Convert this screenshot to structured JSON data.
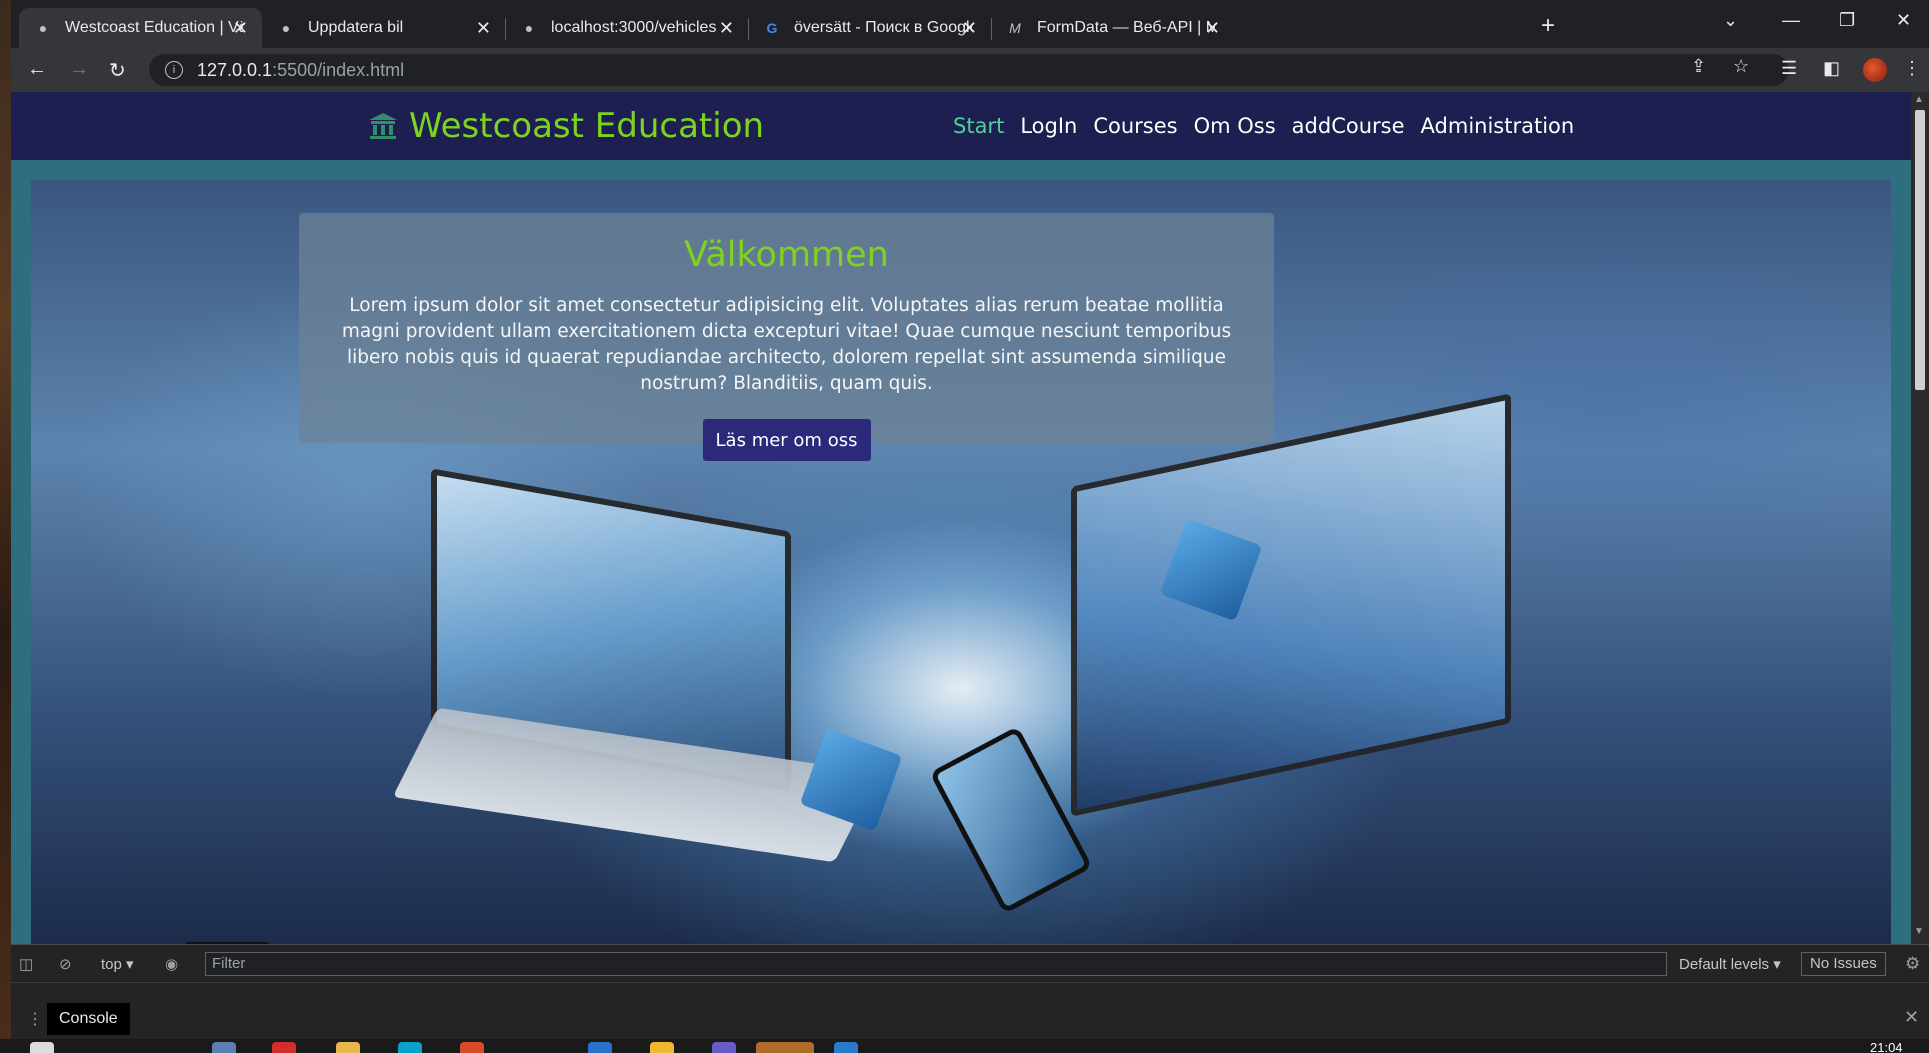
{
  "browser": {
    "tabs": [
      {
        "title": "Westcoast Education | Välkommen",
        "favicon": "globe-icon",
        "active": true
      },
      {
        "title": "Uppdatera bil",
        "favicon": "globe-icon",
        "active": false
      },
      {
        "title": "localhost:3000/vehicles",
        "favicon": "globe-icon",
        "active": false
      },
      {
        "title": "översätt - Поиск в Google",
        "favicon": "google-icon",
        "active": false
      },
      {
        "title": "FormData — Веб-API | MДН",
        "favicon": "mdn-icon",
        "active": false
      }
    ],
    "address": {
      "host": "127.0.0.1",
      "path": ":5500/index.html"
    },
    "mdn_glyph": "M",
    "google_glyph": "G"
  },
  "site": {
    "brand": "Westcoast Education",
    "brand_color": "#7ed321",
    "header_bg": "#1c1f4f",
    "nav": [
      {
        "label": "Start",
        "active": true
      },
      {
        "label": "LogIn",
        "active": false
      },
      {
        "label": "Courses",
        "active": false
      },
      {
        "label": "Om Oss",
        "active": false
      },
      {
        "label": "addCourse",
        "active": false
      },
      {
        "label": "Administration",
        "active": false
      }
    ],
    "hero": {
      "heading": "Välkommen",
      "text": "Lorem ipsum dolor sit amet consectetur adipisicing elit. Voluptates alias rerum beatae mollitia magni provident ullam exercitationem dicta excepturi vitae! Quae cumque nesciunt temporibus libero nobis quis id quaerat repudiandae architecto, dolorem repellat sint assumenda similique nostrum? Blanditiis, quam quis.",
      "button": "Läs mer om oss",
      "button_color": "#2b2a7a"
    }
  },
  "devtools": {
    "context": "top",
    "filter_placeholder": "Filter",
    "levels": "Default levels",
    "issues": "No Issues",
    "drawer_tab": "Console"
  },
  "taskbar": {
    "clock": "21:04"
  }
}
